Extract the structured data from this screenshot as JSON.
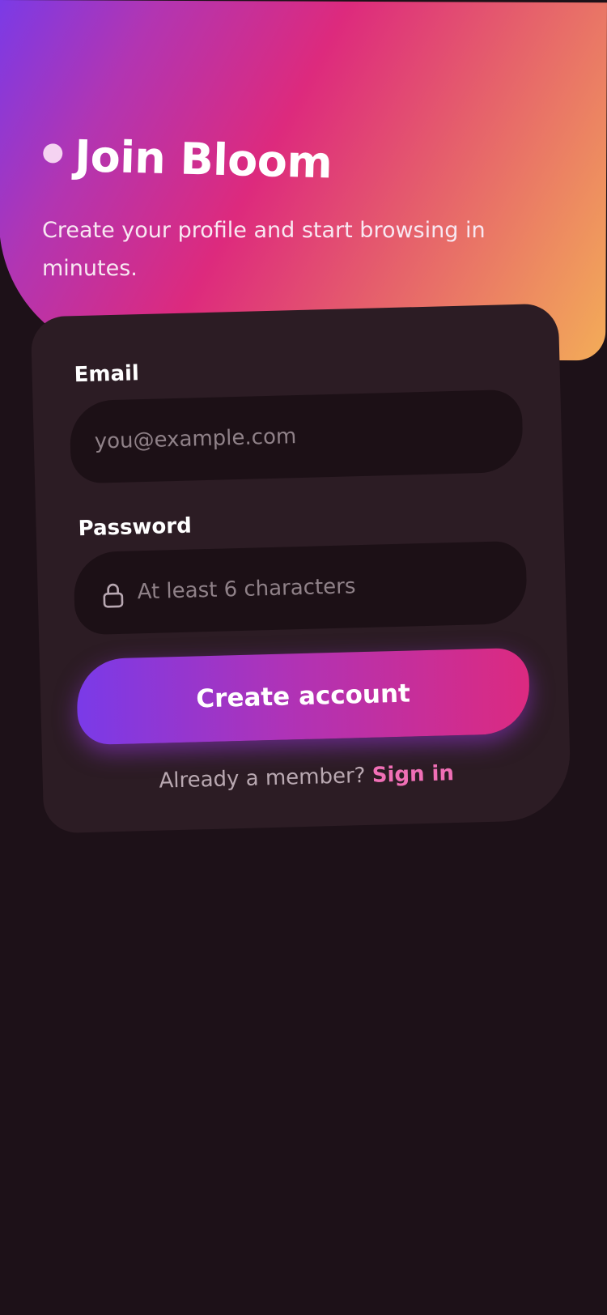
{
  "header": {
    "title": "Join Bloom",
    "subtitle": "Create your profile and start browsing in minutes."
  },
  "form": {
    "email": {
      "label": "Email",
      "placeholder": "you@example.com",
      "value": ""
    },
    "password": {
      "label": "Password",
      "placeholder": "At least 6 characters",
      "value": "",
      "icon": "lock-icon"
    },
    "submit_label": "Create account",
    "signin_prompt": "Already a member?",
    "signin_link": "Sign in"
  },
  "colors": {
    "background": "#1d1118",
    "card": "#2c1c24",
    "input": "#1c1016",
    "accent_purple": "#7a3ae8",
    "accent_pink": "#dc2a80",
    "accent_orange": "#f3ac58",
    "link": "#f06fb6"
  }
}
